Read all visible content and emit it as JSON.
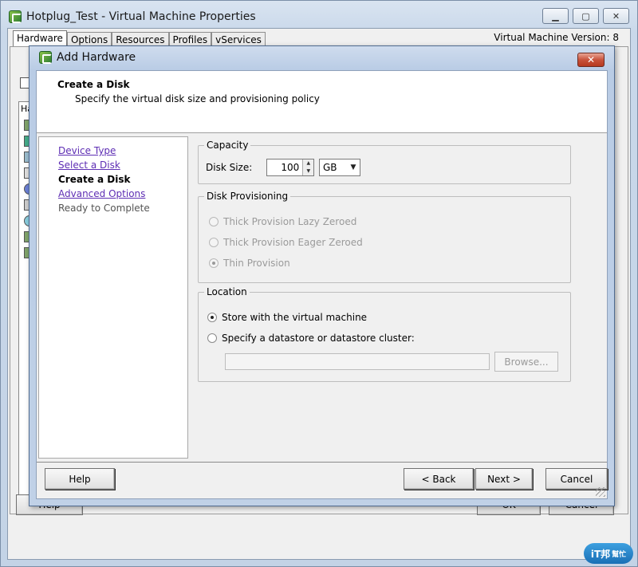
{
  "window": {
    "title": "Hotplug_Test - Virtual Machine Properties",
    "vm_version": "Virtual Machine Version: 8",
    "tabs": [
      "Hardware",
      "Options",
      "Resources",
      "Profiles",
      "vServices"
    ],
    "background_list_label": "Ha",
    "help_label": "Help",
    "ok_label": "OK",
    "cancel_label": "Cancel"
  },
  "dialog": {
    "title": "Add Hardware",
    "header_title": "Create a Disk",
    "header_subtitle": "Specify the virtual disk size and provisioning policy",
    "steps": [
      {
        "label": "Device Type",
        "state": "link"
      },
      {
        "label": "Select a Disk",
        "state": "link"
      },
      {
        "label": "Create a Disk",
        "state": "current"
      },
      {
        "label": "Advanced Options",
        "state": "link"
      },
      {
        "label": "Ready to Complete",
        "state": "pending"
      }
    ],
    "capacity": {
      "legend": "Capacity",
      "disk_size_label": "Disk Size:",
      "disk_size_value": "100",
      "unit_value": "GB"
    },
    "provisioning": {
      "legend": "Disk Provisioning",
      "options": [
        "Thick Provision Lazy Zeroed",
        "Thick Provision Eager Zeroed",
        "Thin Provision"
      ],
      "selected": "Thin Provision"
    },
    "location": {
      "legend": "Location",
      "options": [
        "Store with the virtual machine",
        "Specify a datastore or datastore cluster:"
      ],
      "selected": "Store with the virtual machine",
      "browse_label": "Browse..."
    },
    "buttons": {
      "help": "Help",
      "back": "< Back",
      "next": "Next >",
      "cancel": "Cancel"
    }
  },
  "watermark": {
    "text": "iT邦",
    "subtext": "幫忙"
  },
  "colors": {
    "link": "#5e2eb4",
    "close_button": "#c8533b",
    "title_bar": "#c0d1e7"
  }
}
